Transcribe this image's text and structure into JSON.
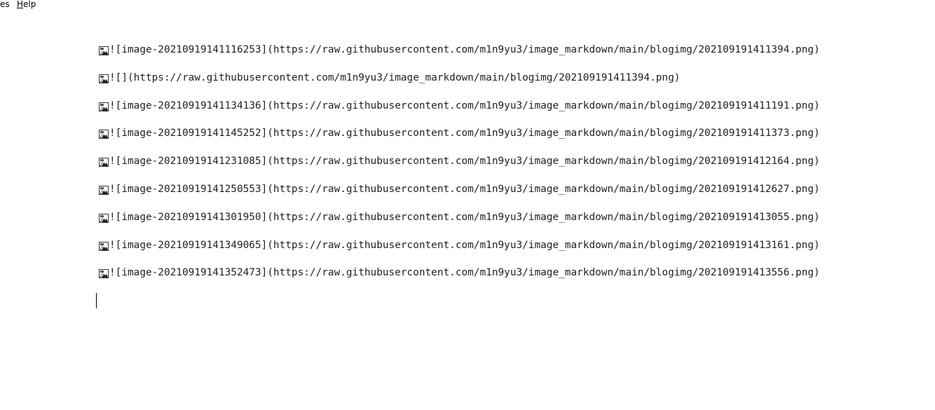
{
  "menubar": {
    "items": [
      {
        "label_rest": "es"
      },
      {
        "underline": "H",
        "label_rest": "elp"
      }
    ]
  },
  "editor": {
    "lines": [
      {
        "icon": "broken-image-icon",
        "text": "![image-20210919141116253](https://raw.githubusercontent.com/m1n9yu3/image_markdown/main/blogimg/202109191411394.png)"
      },
      {
        "icon": "broken-image-icon",
        "text": "![](https://raw.githubusercontent.com/m1n9yu3/image_markdown/main/blogimg/202109191411394.png)"
      },
      {
        "icon": "broken-image-icon",
        "text": "![image-20210919141134136](https://raw.githubusercontent.com/m1n9yu3/image_markdown/main/blogimg/202109191411191.png)"
      },
      {
        "icon": "broken-image-icon",
        "text": "![image-20210919141145252](https://raw.githubusercontent.com/m1n9yu3/image_markdown/main/blogimg/202109191411373.png)"
      },
      {
        "icon": "broken-image-icon",
        "text": "![image-20210919141231085](https://raw.githubusercontent.com/m1n9yu3/image_markdown/main/blogimg/202109191412164.png)"
      },
      {
        "icon": "broken-image-icon",
        "text": "![image-20210919141250553](https://raw.githubusercontent.com/m1n9yu3/image_markdown/main/blogimg/202109191412627.png)"
      },
      {
        "icon": "broken-image-icon",
        "text": "![image-20210919141301950](https://raw.githubusercontent.com/m1n9yu3/image_markdown/main/blogimg/202109191413055.png)"
      },
      {
        "icon": "broken-image-icon",
        "text": "![image-20210919141349065](https://raw.githubusercontent.com/m1n9yu3/image_markdown/main/blogimg/202109191413161.png)"
      },
      {
        "icon": "broken-image-icon",
        "text": "![image-20210919141352473](https://raw.githubusercontent.com/m1n9yu3/image_markdown/main/blogimg/202109191413556.png)"
      }
    ]
  }
}
